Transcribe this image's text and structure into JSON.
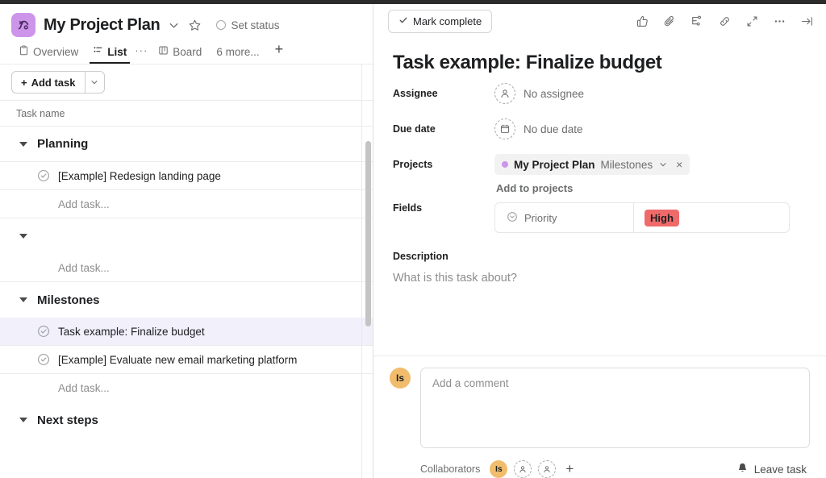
{
  "project": {
    "icon": "project-chart-icon",
    "title": "My Project Plan",
    "chevron": "chevron-down-icon",
    "star": "star-icon",
    "set_status": "Set status",
    "accent_color": "#cd95ea"
  },
  "tabs": {
    "items": [
      {
        "label": "Overview",
        "icon": "clipboard-icon",
        "active": false
      },
      {
        "label": "List",
        "icon": "list-icon",
        "active": true
      },
      {
        "label": "Board",
        "icon": "board-icon",
        "active": false
      },
      {
        "label": "6 more...",
        "icon": "",
        "active": false
      }
    ],
    "overflow_dots": "···",
    "add_tab": "+"
  },
  "toolbar": {
    "add_task_label": "Add task",
    "add_task_plus": "+",
    "add_task_caret": "chevron-down-icon"
  },
  "list": {
    "column_header": "Task name",
    "add_task_placeholder": "Add task...",
    "sections": [
      {
        "name": "Planning",
        "tasks": [
          {
            "name": "[Example] Redesign landing page",
            "selected": false
          }
        ]
      },
      {
        "name": "",
        "tasks": []
      },
      {
        "name": "Milestones",
        "tasks": [
          {
            "name": "Task example: Finalize budget",
            "selected": true
          },
          {
            "name": "[Example] Evaluate new email marketing platform",
            "selected": false
          }
        ]
      },
      {
        "name": "Next steps",
        "tasks": []
      }
    ]
  },
  "detail": {
    "mark_complete": "Mark complete",
    "icons": [
      "thumbs-up-icon",
      "paperclip-icon",
      "subtask-icon",
      "link-icon",
      "expand-icon",
      "more-options-icon",
      "collapse-panel-icon"
    ],
    "title": "Task example: Finalize budget",
    "assignee": {
      "label": "Assignee",
      "value": "No assignee",
      "icon": "person-icon"
    },
    "due_date": {
      "label": "Due date",
      "value": "No due date",
      "icon": "calendar-icon"
    },
    "projects": {
      "label": "Projects",
      "project_name": "My Project Plan",
      "section_name": "Milestones",
      "chevron": "chevron-down-icon",
      "remove": "×",
      "add_link": "Add to projects",
      "dot_color": "#cd95ea"
    },
    "fields": {
      "label": "Fields",
      "key": "Priority",
      "key_icon": "dropdown-circle-icon",
      "value": "High",
      "value_color": "#f06a6a"
    },
    "description": {
      "label": "Description",
      "placeholder": "What is this task about?"
    }
  },
  "comments": {
    "avatar_initials": "Is",
    "avatar_color": "#f1bd6c",
    "placeholder": "Add a comment",
    "collaborators_label": "Collaborators",
    "collaborator_initials": "Is",
    "placeholder_avatars": 2,
    "add_collaborator": "+",
    "leave_task": "Leave task",
    "leave_task_icon": "bell-icon"
  }
}
